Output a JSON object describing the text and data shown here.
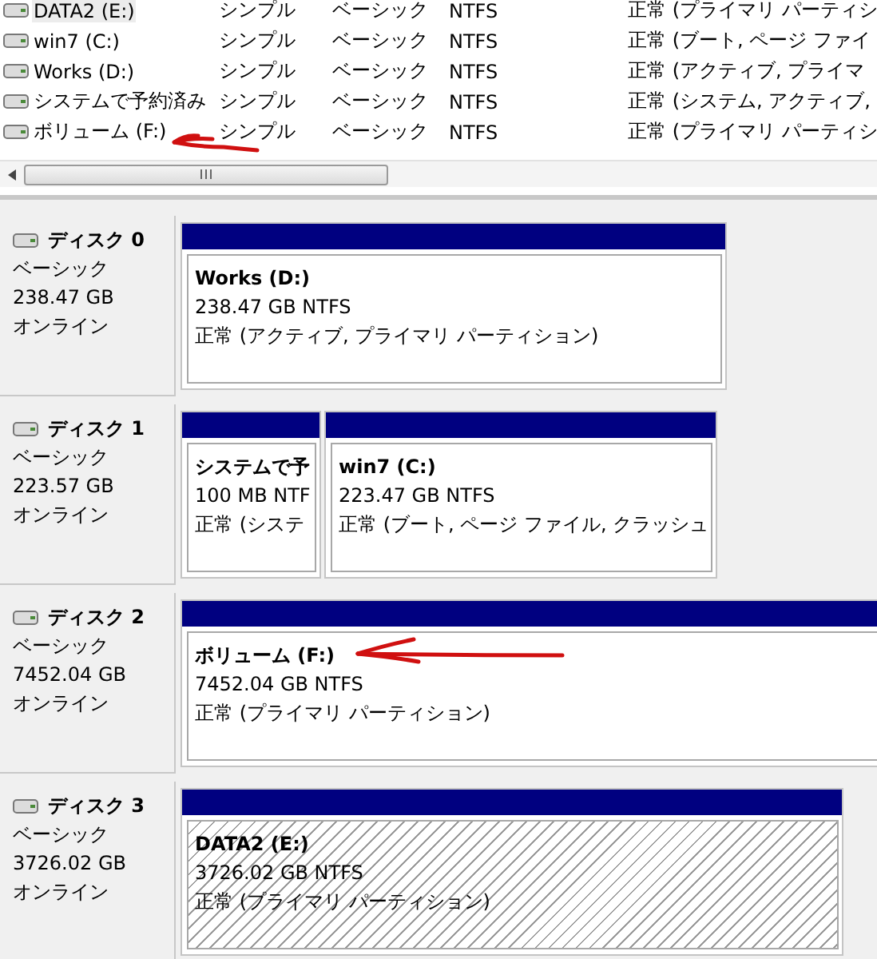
{
  "volume_list": {
    "rows": [
      {
        "name": "DATA2 (E:)",
        "layout": "シンプル",
        "type": "ベーシック",
        "file_system": "NTFS",
        "status": "正常 (プライマリ パーティシ",
        "selected": true
      },
      {
        "name": "win7 (C:)",
        "layout": "シンプル",
        "type": "ベーシック",
        "file_system": "NTFS",
        "status": "正常 (ブート, ページ ファイ",
        "selected": false
      },
      {
        "name": "Works (D:)",
        "layout": "シンプル",
        "type": "ベーシック",
        "file_system": "NTFS",
        "status": "正常 (アクティブ, プライマ",
        "selected": false
      },
      {
        "name": "システムで予約済み",
        "layout": "シンプル",
        "type": "ベーシック",
        "file_system": "NTFS",
        "status": "正常 (システム, アクティブ,",
        "selected": false
      },
      {
        "name": "ボリューム (F:)",
        "layout": "シンプル",
        "type": "ベーシック",
        "file_system": "NTFS",
        "status": "正常 (プライマリ パーティシ",
        "selected": false
      }
    ]
  },
  "disks": [
    {
      "label": "ディスク 0",
      "type": "ベーシック",
      "size": "238.47 GB",
      "status": "オンライン",
      "partitions": [
        {
          "name": "Works  (D:)",
          "size_fs": "238.47 GB NTFS",
          "status": "正常 (アクティブ, プライマリ パーティション)",
          "selected": false
        }
      ]
    },
    {
      "label": "ディスク 1",
      "type": "ベーシック",
      "size": "223.57 GB",
      "status": "オンライン",
      "partitions": [
        {
          "name": "システムで予",
          "size_fs": "100 MB NTF",
          "status": "正常 (システ",
          "selected": false
        },
        {
          "name": "win7  (C:)",
          "size_fs": "223.47 GB NTFS",
          "status": "正常 (ブート, ページ ファイル, クラッシュ",
          "selected": false
        }
      ]
    },
    {
      "label": "ディスク 2",
      "type": "ベーシック",
      "size": "7452.04 GB",
      "status": "オンライン",
      "partitions": [
        {
          "name": "ボリューム  (F:)",
          "size_fs": "7452.04 GB NTFS",
          "status": "正常 (プライマリ パーティション)",
          "selected": false
        }
      ]
    },
    {
      "label": "ディスク 3",
      "type": "ベーシック",
      "size": "3726.02 GB",
      "status": "オンライン",
      "partitions": [
        {
          "name": "DATA2  (E:)",
          "size_fs": "3726.02 GB NTFS",
          "status": "正常 (プライマリ パーティション)",
          "selected": true
        }
      ]
    }
  ]
}
